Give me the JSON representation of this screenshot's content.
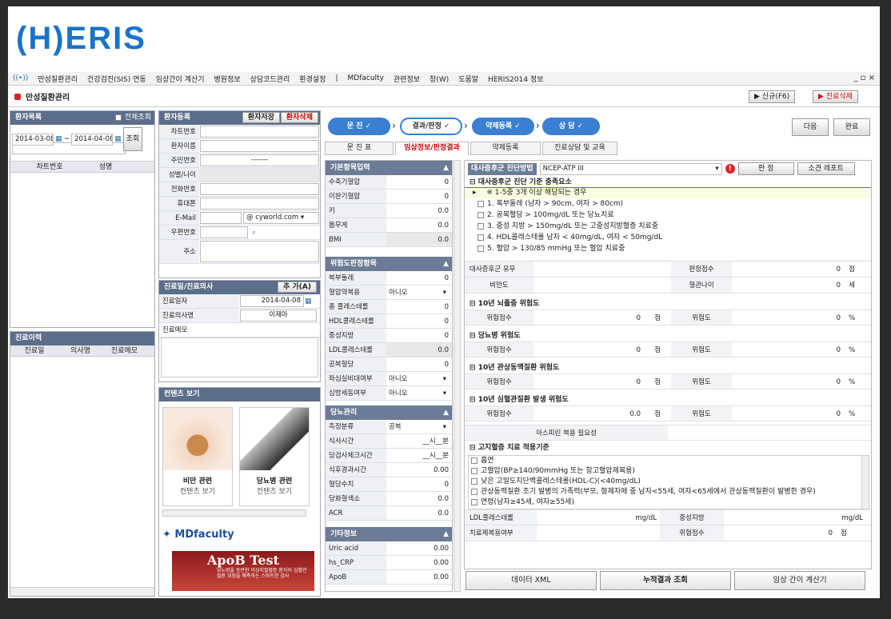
{
  "logo": "(H)ERIS",
  "menu": [
    "만성질환관리",
    "건강검진(SIS) 연동",
    "임상간이 계산기",
    "병원정보",
    "상담코드관리",
    "환경설정",
    "|",
    "MDfaculty",
    "관련정보",
    "창(W)",
    "도움말",
    "HERIS2014 정보"
  ],
  "window_controls": "_ ▫ ×",
  "page_title": "만성질환관리",
  "top_buttons": {
    "new": "▶ 신규(F6)",
    "delete": "▶ 진료삭제"
  },
  "patient_list": {
    "title": "환자목록",
    "view_all": "전체조회",
    "date_from": "2014-03-08",
    "date_to": "2014-04-08",
    "search_btn": "조회",
    "col_chart": "차트번호",
    "col_name": "성명"
  },
  "history": {
    "title": "진료이력",
    "cols": [
      "진료일",
      "의사명",
      "진료메모"
    ]
  },
  "patient_reg": {
    "title": "환자등록",
    "save": "환자저장",
    "delete": "환자삭제",
    "fields": [
      "차트번호",
      "환자이름",
      "주민번호",
      "성별/나이",
      "전화번호",
      "휴대폰",
      "E-Mail",
      "우편번호",
      "주소"
    ],
    "ssn_placeholder": "-------",
    "email_domain": "cyworld.com"
  },
  "visit": {
    "title": "진료일/진료의사",
    "add": "추 가(A)",
    "date_label": "진료일자",
    "date_val": "2014-04-08",
    "doctor_label": "진료의사명",
    "doctor_val": "이재마",
    "memo_label": "진료메모"
  },
  "contents": {
    "title": "컨텐츠 보기",
    "card1_title": "비만 관련",
    "card1_sub": "컨텐츠 보기",
    "card2_title": "당뇨병 관련",
    "card2_sub": "컨텐츠 보기",
    "md_logo": "MDfaculty",
    "apob": "ApoB Test",
    "apob_desc": "당뇨병을 동반한 이상지질혈증 환자의 심혈관질환 위험을 예측하는 스마트한 검사"
  },
  "steps": [
    "문 진",
    "결과/판정",
    "약제등록",
    "상 담"
  ],
  "step_buttons": {
    "next": "다음",
    "done": "완료"
  },
  "tabs": [
    "문 진 표",
    "임상정보/판정결과",
    "약제등록",
    "진료상담 및 교육"
  ],
  "basic": {
    "title": "기본항목입력",
    "items": [
      {
        "l": "수축기혈압",
        "v": "0"
      },
      {
        "l": "이완기혈압",
        "v": "0"
      },
      {
        "l": "키",
        "v": "0.0"
      },
      {
        "l": "몸무게",
        "v": "0.0"
      },
      {
        "l": "BMI",
        "v": "0.0"
      }
    ]
  },
  "risk": {
    "title": "위험도판정항목",
    "items": [
      {
        "l": "복부둘레",
        "v": "0"
      },
      {
        "l": "혈압약복용",
        "v": "아니오"
      },
      {
        "l": "총 콜레스테롤",
        "v": "0"
      },
      {
        "l": "HDL콜레스테롤",
        "v": "0"
      },
      {
        "l": "중성지방",
        "v": "0"
      },
      {
        "l": "LDL콜레스테롤",
        "v": "0.0"
      },
      {
        "l": "공복혈당",
        "v": "0"
      },
      {
        "l": "좌심실비대여부",
        "v": "아니오"
      },
      {
        "l": "심방세동여부",
        "v": "아니오"
      }
    ]
  },
  "diabetes": {
    "title": "당뇨관리",
    "items": [
      {
        "l": "측정분류",
        "v": "공복"
      },
      {
        "l": "식사시간",
        "v": "__시__분"
      },
      {
        "l": "당검사체크시간",
        "v": "__시__분"
      },
      {
        "l": "식후경과시간",
        "v": "0.00"
      },
      {
        "l": "혈당수치",
        "v": "0"
      },
      {
        "l": "당화혈색소",
        "v": "0.0"
      },
      {
        "l": "ACR",
        "v": "0.0"
      }
    ]
  },
  "other": {
    "title": "기타정보",
    "items": [
      {
        "l": "Uric acid",
        "v": "0.00"
      },
      {
        "l": "hs_CRP",
        "v": "0.00"
      },
      {
        "l": "ApoB",
        "v": "0.00"
      }
    ]
  },
  "result": {
    "ms_label": "대사증후군 진단방법",
    "ms_method": "NCEP-ATP III",
    "judge_btn": "판 정",
    "report_btn": "소견 레포트",
    "criteria_title": "대사증후군 진단 기준 충족요소",
    "criteria_note": "※ 1-5중 3개 이상 해당되는 경우",
    "criteria": [
      "1. 복부둘레 (남자 > 90cm, 여자 > 80cm)",
      "2. 공복혈당 > 100mg/dL 또는 당뇨치료",
      "3. 중성 지방 > 150mg/dL 또는 고중성지방혈증 치료중",
      "4. HDL콜레스테롤 남자 < 40mg/dL, 여자 < 50mg/dL",
      "5. 혈압 > 130/85 mmHg 또는 혈압 치료중"
    ],
    "ms_yn": "대사증후군 유무",
    "score_label": "판정점수",
    "score_val": "0",
    "score_unit": "점",
    "obesity": "비만도",
    "vessel_age": "혈관나이",
    "vessel_val": "0",
    "vessel_unit": "세",
    "stroke": "10년 뇌졸중 위험도",
    "dm": "당뇨병 위험도",
    "chd": "10년 관상동맥질환 위험도",
    "cvd": "10년 심혈관질환 발생 위험도",
    "risk_score": "위험점수",
    "risk_deg": "위험도",
    "pt": "점",
    "pct": "%",
    "cvd_score": "0.0",
    "aspirin": "아스피린 복용 필요성",
    "lipid_title": "고지혈증 치료 적용기준",
    "lipid": [
      "흡연",
      "고혈압(BP≥140/90mmHg 또는 항고혈압제복용)",
      "낮은 고밀도지단백콜레스테롤(HDL-C)(<40mg/dL)",
      "관상동맥질환 조기 발병의 가족력(부모, 형제자매 중 남자<55세, 여자<65세에서 관상동맥질환이 발병한 경우)",
      "연령(남자≥45세, 여자≥55세)"
    ],
    "ldl": "LDL콜레스테롤",
    "mgdl": "mg/dL",
    "tg": "중성지방",
    "tx": "치료제복용여부",
    "risk_pt": "위험점수",
    "zero": "0"
  },
  "bottom_btns": [
    "데이터 XML",
    "누적결과 조회",
    "임상 간이 계산기"
  ]
}
